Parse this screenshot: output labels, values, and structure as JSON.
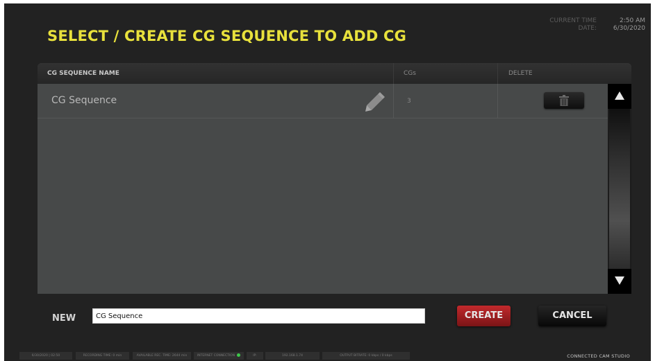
{
  "header": {
    "title": "SELECT / CREATE CG SEQUENCE TO ADD CG",
    "current_time_label": "CURRENT TIME",
    "current_time_value": "2:50 AM",
    "date_label": "DATE:",
    "date_value": "6/30/2020"
  },
  "table": {
    "columns": {
      "name": "CG SEQUENCE NAME",
      "count": "CGs",
      "delete": "DELETE"
    },
    "rows": [
      {
        "name": "CG Sequence",
        "count": "3"
      }
    ]
  },
  "form": {
    "new_label": "NEW",
    "input_value": "CG Sequence",
    "create_label": "CREATE",
    "cancel_label": "CANCEL"
  },
  "status_bar": {
    "items": [
      "6/30/2020 | 02:50",
      "RECORDING TIME: 0 min",
      "AVAILABLE REC. TIME: 2644 min",
      "INTERNET CONNECTION",
      "IP:",
      "192.168.1.74",
      "OUTPUT BITRATE:   0 kbps / 0 kbps"
    ],
    "brand": "CONNECTED CAM STUDIO"
  },
  "colors": {
    "title": "#e8e13c",
    "create_button": "#b02226",
    "internet_ok": "#3ec94b"
  },
  "icons": [
    "pencil-icon",
    "trash-icon",
    "arrow-up-icon",
    "arrow-down-icon"
  ]
}
